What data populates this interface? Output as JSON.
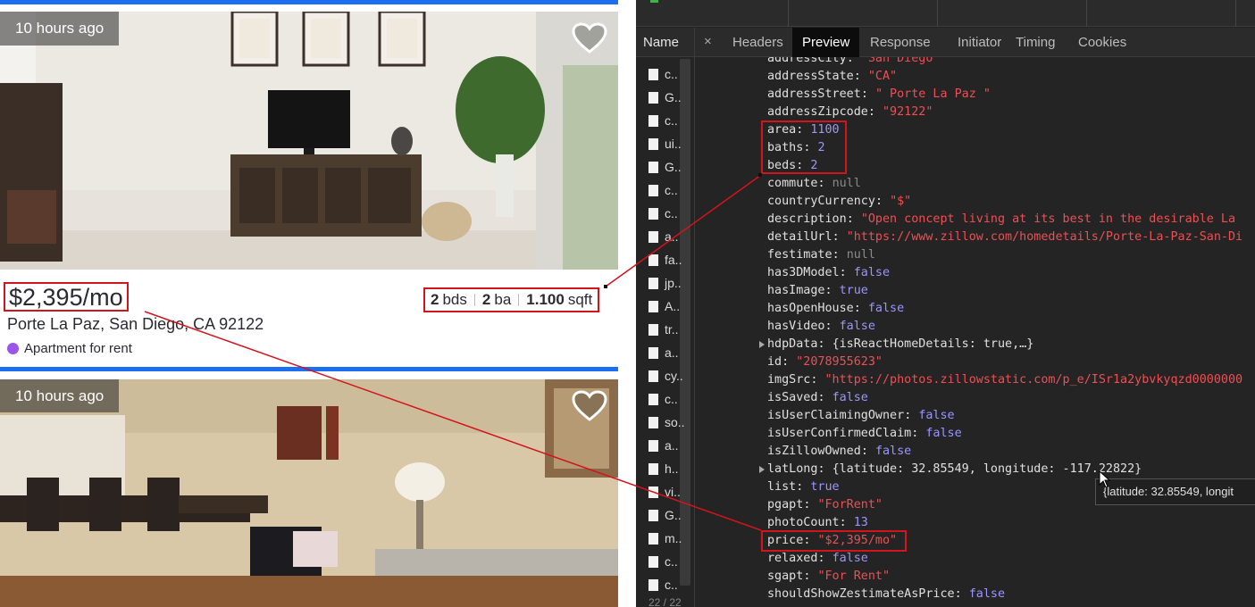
{
  "listing1": {
    "time_ago": "10 hours ago",
    "price": "$2,395/mo",
    "beds_num": "2",
    "beds_unit": "bds",
    "baths_num": "2",
    "baths_unit": "ba",
    "area_num": "1.100",
    "area_unit": "sqft",
    "address": "Porte La Paz, San Diego, CA 92122",
    "type": "Apartment for rent",
    "type_color": "#9a56e8"
  },
  "listing2": {
    "time_ago": "10 hours ago"
  },
  "devtools": {
    "name_header": "Name",
    "close_glyph": "×",
    "tabs": [
      "Headers",
      "Preview",
      "Response",
      "Initiator",
      "Timing",
      "Cookies"
    ],
    "active_tab": "Preview",
    "name_rows": [
      "c..",
      "G..",
      "c..",
      "ui..",
      "G..",
      "c..",
      "c..",
      "a..",
      "fa..",
      "jp..",
      "A..",
      "tr..",
      "a..",
      "cy..",
      "c..",
      "so..",
      "a..",
      "h..",
      "vi..",
      "G..",
      "m..",
      "c..",
      "c.."
    ],
    "footer": "22 / 22",
    "tooltip": "{latitude: 32.85549, longit",
    "json_lines": [
      {
        "key": "addressCity",
        "val": "\"San Diego\"",
        "kind": "jstr"
      },
      {
        "key": "addressState",
        "val": "\"CA\"",
        "kind": "jstr"
      },
      {
        "key": "addressStreet",
        "val": "\" Porte La Paz \"",
        "kind": "jstr"
      },
      {
        "key": "addressZipcode",
        "val": "\"92122\"",
        "kind": "jstr"
      },
      {
        "key": "area",
        "val": "1100",
        "kind": "jnum"
      },
      {
        "key": "baths",
        "val": "2",
        "kind": "jnum"
      },
      {
        "key": "beds",
        "val": "2",
        "kind": "jnum"
      },
      {
        "key": "commute",
        "val": "null",
        "kind": "jnull"
      },
      {
        "key": "countryCurrency",
        "val": "\"$\"",
        "kind": "jstr"
      },
      {
        "key": "description",
        "val": "\"Open concept living at its best in the desirable La",
        "kind": "jstr"
      },
      {
        "key": "detailUrl",
        "val": "\"https://www.zillow.com/homedetails/Porte-La-Paz-San-Di",
        "kind": "jstr"
      },
      {
        "key": "festimate",
        "val": "null",
        "kind": "jnull"
      },
      {
        "key": "has3DModel",
        "val": "false",
        "kind": "jbool"
      },
      {
        "key": "hasImage",
        "val": "true",
        "kind": "jbool"
      },
      {
        "key": "hasOpenHouse",
        "val": "false",
        "kind": "jbool"
      },
      {
        "key": "hasVideo",
        "val": "false",
        "kind": "jbool"
      },
      {
        "key": "hdpData",
        "val": "{isReactHomeDetails: true,…}",
        "kind": "jobj",
        "expand": true
      },
      {
        "key": "id",
        "val": "\"2078955623\"",
        "kind": "jstr"
      },
      {
        "key": "imgSrc",
        "val": "\"https://photos.zillowstatic.com/p_e/ISr1a2ybvkyqzd0000000",
        "kind": "jstr"
      },
      {
        "key": "isSaved",
        "val": "false",
        "kind": "jbool"
      },
      {
        "key": "isUserClaimingOwner",
        "val": "false",
        "kind": "jbool"
      },
      {
        "key": "isUserConfirmedClaim",
        "val": "false",
        "kind": "jbool"
      },
      {
        "key": "isZillowOwned",
        "val": "false",
        "kind": "jbool"
      },
      {
        "key": "latLong",
        "val": "{latitude: 32.85549, longitude: -117.22822}",
        "kind": "jobj",
        "expand": true
      },
      {
        "key": "list",
        "val": "true",
        "kind": "jbool"
      },
      {
        "key": "pgapt",
        "val": "\"ForRent\"",
        "kind": "jstr"
      },
      {
        "key": "photoCount",
        "val": "13",
        "kind": "jnum"
      },
      {
        "key": "price",
        "val": "\"$2,395/mo\"",
        "kind": "jstr"
      },
      {
        "key": "relaxed",
        "val": "false",
        "kind": "jbool"
      },
      {
        "key": "sgapt",
        "val": "\"For Rent\"",
        "kind": "jstr"
      },
      {
        "key": "shouldShowZestimateAsPrice",
        "val": "false",
        "kind": "jbool"
      }
    ]
  },
  "colors": {
    "annotation_red": "#d2141c",
    "zillow_blue": "#1d6ff2",
    "json_string": "#ee4f54",
    "json_number": "#9b95ff"
  }
}
